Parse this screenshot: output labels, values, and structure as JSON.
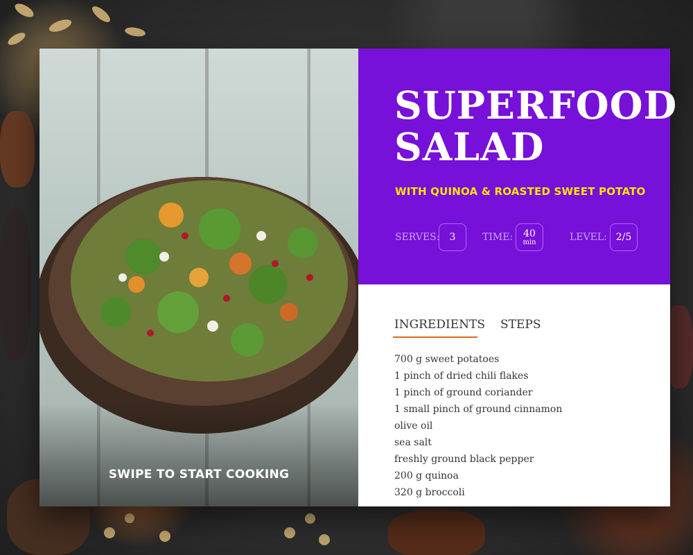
{
  "recipe": {
    "title_line1": "SUPERFOOD",
    "title_line2": "SALAD",
    "subtitle": "WITH QUINOA & ROASTED SWEET POTATO",
    "photo_alt": "salad-bowl-photo",
    "swipe_label": "SWIPE TO START COOKING"
  },
  "meta": {
    "serves_label": "SERVES:",
    "serves_value": "3",
    "time_label": "TIME:",
    "time_value": "40",
    "time_unit": "min",
    "level_label": "LEVEL:",
    "level_value": "2/5"
  },
  "tabs": {
    "ingredients": "INGREDIENTS",
    "steps": "STEPS",
    "active": "ingredients"
  },
  "ingredients": [
    "700  g sweet potatoes",
    "1 pinch of dried chili flakes",
    "1 pinch of ground coriander",
    "1 small pinch of ground cinnamon",
    "olive oil",
    "sea salt",
    "freshly ground black pepper",
    "200 g quinoa",
    "320 g broccoli"
  ],
  "colors": {
    "accent_purple": "#7710d8",
    "subtitle_yellow": "#ffe600",
    "tab_underline": "#e0661f"
  }
}
